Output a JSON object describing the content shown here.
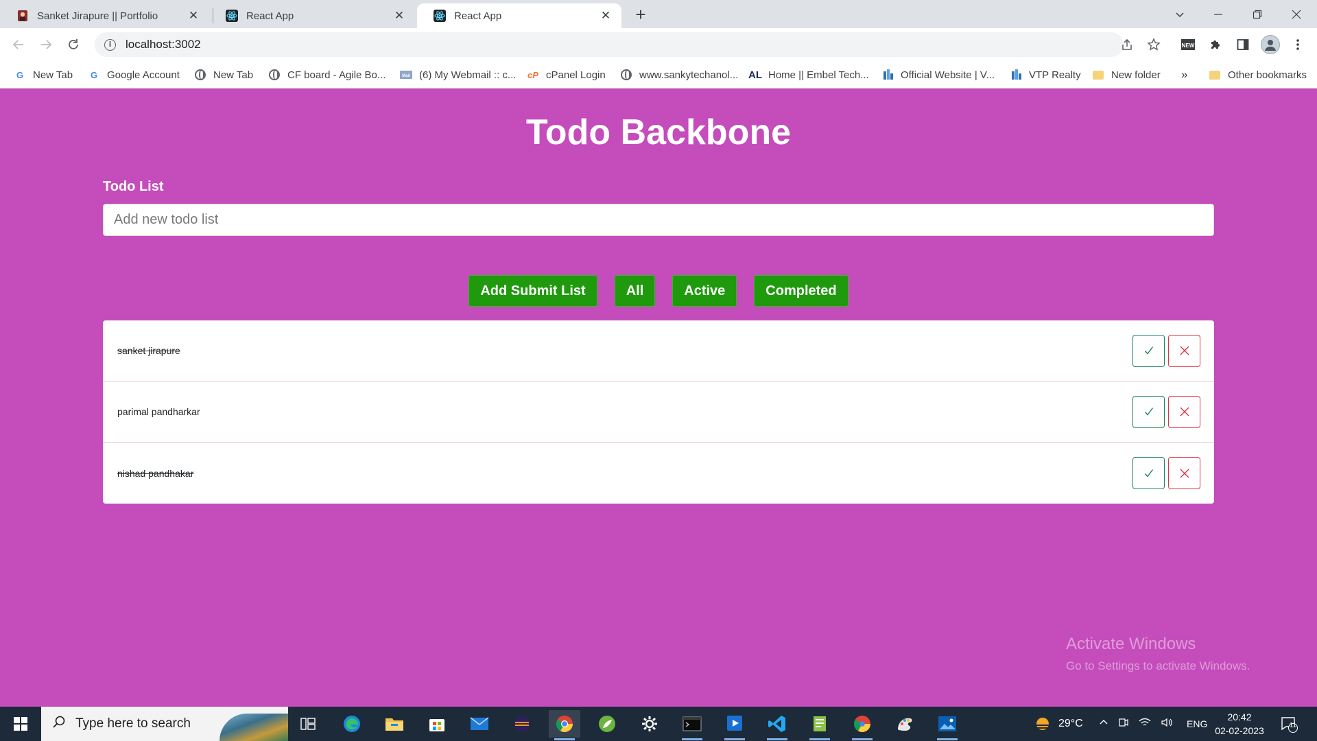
{
  "browser": {
    "tabs": [
      {
        "title": "Sanket Jirapure || Portfolio",
        "active": false
      },
      {
        "title": "React App",
        "active": false
      },
      {
        "title": "React App",
        "active": true
      }
    ],
    "address": "localhost:3002",
    "bookmarks": [
      {
        "label": "New Tab",
        "icon": "google-icon"
      },
      {
        "label": "Google Account",
        "icon": "google-icon"
      },
      {
        "label": "New Tab",
        "icon": "globe-icon"
      },
      {
        "label": "CF board - Agile Bo...",
        "icon": "globe-icon"
      },
      {
        "label": "(6) My Webmail :: c...",
        "icon": "webmail-icon"
      },
      {
        "label": "cPanel Login",
        "icon": "cpanel-icon"
      },
      {
        "label": "www.sankytechanol...",
        "icon": "globe-icon"
      },
      {
        "label": "Home || Embel Tech...",
        "icon": "al-icon"
      },
      {
        "label": "Official Website | V...",
        "icon": "vtp-icon"
      },
      {
        "label": "VTP Realty",
        "icon": "vtp-icon"
      },
      {
        "label": "New folder",
        "icon": "folder-icon"
      }
    ],
    "more_bookmarks": "»",
    "other_bookmarks": "Other bookmarks"
  },
  "app": {
    "title": "Todo Backbone",
    "input_label": "Todo List",
    "input_placeholder": "Add new todo list",
    "buttons": {
      "submit": "Add Submit List",
      "all": "All",
      "active": "Active",
      "completed": "Completed"
    },
    "todos": [
      {
        "text": "sanket jirapure",
        "completed": true
      },
      {
        "text": "parimal pandharkar",
        "completed": false
      },
      {
        "text": "nishad pandhakar",
        "completed": true
      }
    ],
    "colors": {
      "background": "#c44cbb",
      "button": "#1f9a0d",
      "check": "#198754",
      "remove": "#dc3545"
    }
  },
  "watermark": {
    "line1": "Activate Windows",
    "line2": "Go to Settings to activate Windows."
  },
  "taskbar": {
    "search_placeholder": "Type here to search",
    "weather": "29°C",
    "language": "ENG",
    "time": "20:42",
    "date": "02-02-2023",
    "notifications": "11"
  }
}
